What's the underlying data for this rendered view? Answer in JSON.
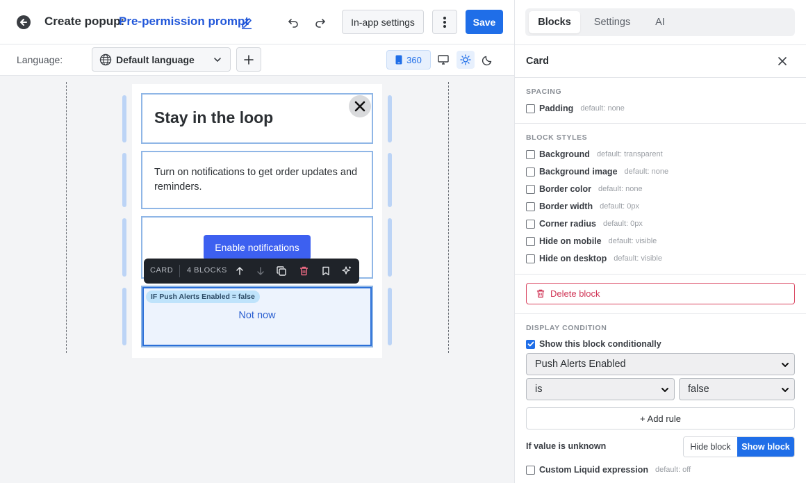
{
  "header": {
    "title_prefix": "Create popup:",
    "title_name": "Pre-permission prompt",
    "inapp_settings_label": "In-app settings",
    "save_label": "Save"
  },
  "language_bar": {
    "label": "Language:",
    "selected_language": "Default language",
    "device_width": "360"
  },
  "popup": {
    "title": "Stay in the loop",
    "body": "Turn on notifications to get order updates and reminders.",
    "enable_label": "Enable notifications",
    "not_now_label": "Not now",
    "condition_pill": "IF Push Alerts Enabled = false"
  },
  "block_toolbar": {
    "type_label": "CARD",
    "count_label": "4 BLOCKS"
  },
  "panel": {
    "tabs": [
      {
        "label": "Blocks",
        "active": true
      },
      {
        "label": "Settings",
        "active": false
      },
      {
        "label": "AI",
        "active": false
      }
    ],
    "card_title": "Card",
    "spacing": {
      "heading": "SPACING",
      "options": [
        {
          "label": "Padding",
          "default": "default: none",
          "checked": false
        }
      ]
    },
    "block_styles": {
      "heading": "BLOCK STYLES",
      "options": [
        {
          "label": "Background",
          "default": "default: transparent",
          "checked": false
        },
        {
          "label": "Background image",
          "default": "default: none",
          "checked": false
        },
        {
          "label": "Border color",
          "default": "default: none",
          "checked": false
        },
        {
          "label": "Border width",
          "default": "default: 0px",
          "checked": false
        },
        {
          "label": "Corner radius",
          "default": "default: 0px",
          "checked": false
        },
        {
          "label": "Hide on mobile",
          "default": "default: visible",
          "checked": false
        },
        {
          "label": "Hide on desktop",
          "default": "default: visible",
          "checked": false
        }
      ]
    },
    "delete_label": "Delete block",
    "display_condition": {
      "heading": "DISPLAY CONDITION",
      "show_conditionally_label": "Show this block conditionally",
      "show_conditionally_checked": true,
      "field": "Push Alerts Enabled",
      "operator": "is",
      "value": "false",
      "add_rule_label": "+ Add rule",
      "unknown_label": "If value is unknown",
      "hide_block_label": "Hide block",
      "show_block_label": "Show block",
      "unknown_selected": "Show block",
      "custom_liquid_label": "Custom Liquid expression",
      "custom_liquid_default": "default: off",
      "custom_liquid_checked": false
    }
  },
  "colors": {
    "accent": "#1f6ee8",
    "title_link": "#2157d9",
    "cta": "#3d60f0",
    "danger": "#d03556",
    "toolbar_bg": "#1f2329"
  },
  "icons": [
    "back-arrow-icon",
    "pencil-icon",
    "undo-icon",
    "redo-icon",
    "kebab-icon",
    "globe-icon",
    "chevron-down-icon",
    "plus-icon",
    "mobile-icon",
    "desktop-icon",
    "sun-icon",
    "moon-icon",
    "close-icon",
    "arrow-up-icon",
    "arrow-down-icon",
    "duplicate-icon",
    "trash-icon",
    "bookmark-icon",
    "sparkle-icon"
  ]
}
